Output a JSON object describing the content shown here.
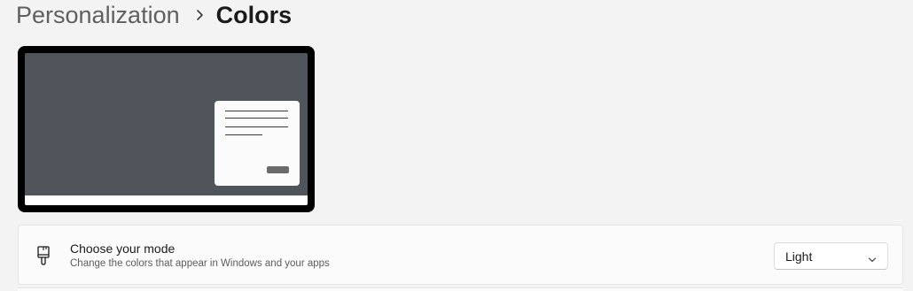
{
  "breadcrumb": {
    "parent": "Personalization",
    "current": "Colors",
    "separator_icon": "chevron-right-icon"
  },
  "preview": {
    "screen_color": "#4f555b",
    "taskbar_color": "#ffffff",
    "window_color": "#fbfbfb"
  },
  "mode_setting": {
    "icon": "paintbrush-icon",
    "title": "Choose your mode",
    "description": "Change the colors that appear in Windows and your apps",
    "selected_value": "Light",
    "dropdown_icon": "chevron-down-icon"
  }
}
